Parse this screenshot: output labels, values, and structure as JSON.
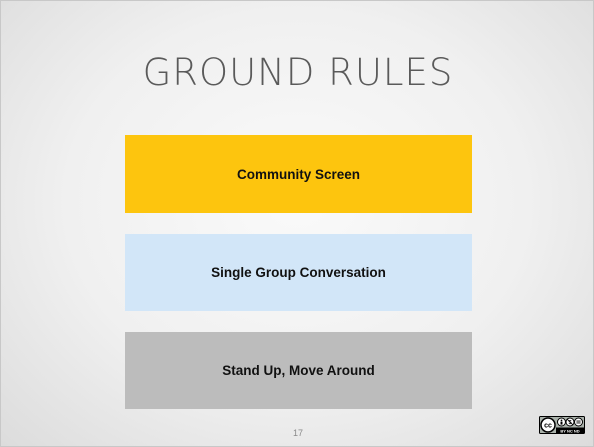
{
  "slide": {
    "title": "GROUND RULES",
    "page_number": "17",
    "rules": [
      {
        "label": "Community Screen",
        "color": "#fdc50e"
      },
      {
        "label": "Single Group Conversation",
        "color": "#d2e6f8"
      },
      {
        "label": "Stand Up, Move Around",
        "color": "#bcbcbc"
      }
    ],
    "license_badge": {
      "icon": "creative-commons-by-nc-nd-icon",
      "text": "BY NC ND"
    }
  }
}
